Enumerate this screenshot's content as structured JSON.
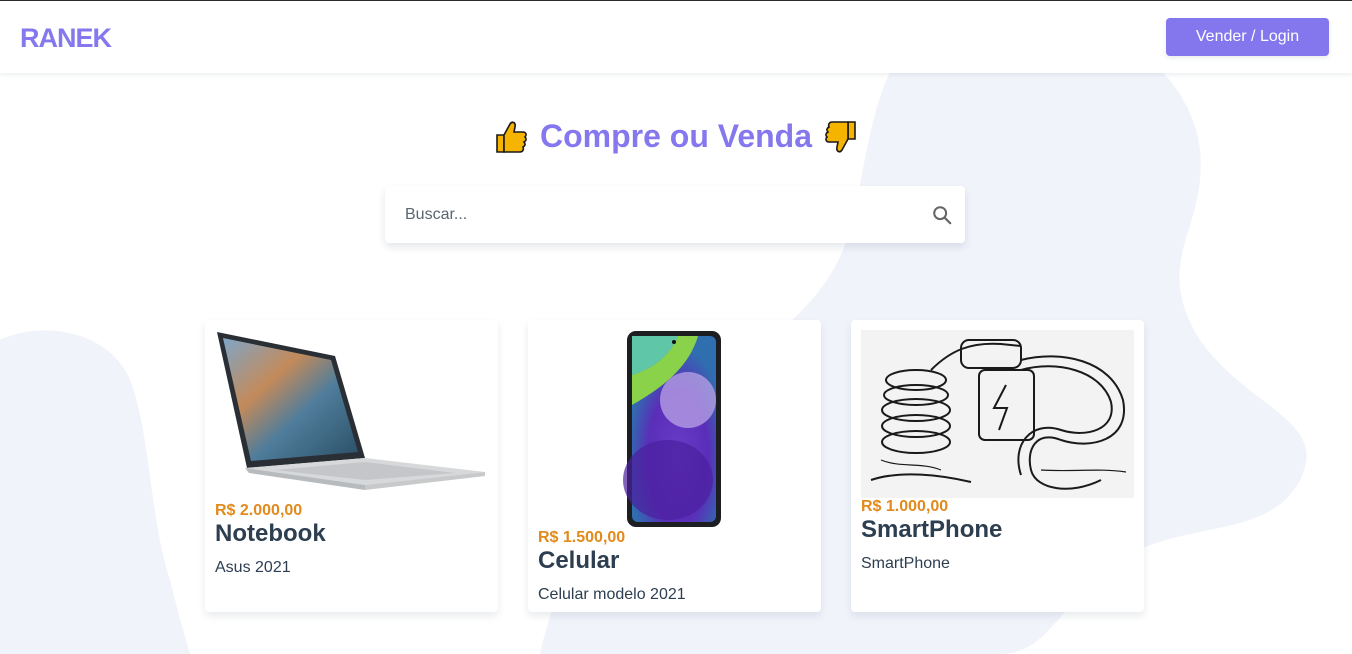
{
  "header": {
    "logo_text": "RANEK",
    "login_button": "Vender / Login"
  },
  "hero": {
    "thumbs_up": "👍",
    "title": "Compre ou Venda",
    "thumbs_down": "👎"
  },
  "search": {
    "placeholder": "Buscar..."
  },
  "products": [
    {
      "price": "R$ 2.000,00",
      "name": "Notebook",
      "description": "Asus 2021",
      "image": "laptop"
    },
    {
      "price": "R$ 1.500,00",
      "name": "Celular",
      "description": "Celular modelo 2021",
      "image": "smartphone"
    },
    {
      "price": "R$ 1.000,00",
      "name": "SmartPhone",
      "description": "SmartPhone",
      "image": "plug-sketch"
    }
  ],
  "colors": {
    "brand": "#8577ee",
    "price": "#e28a1c",
    "text": "#2c3e50",
    "background_shape": "#f2f4fb"
  }
}
